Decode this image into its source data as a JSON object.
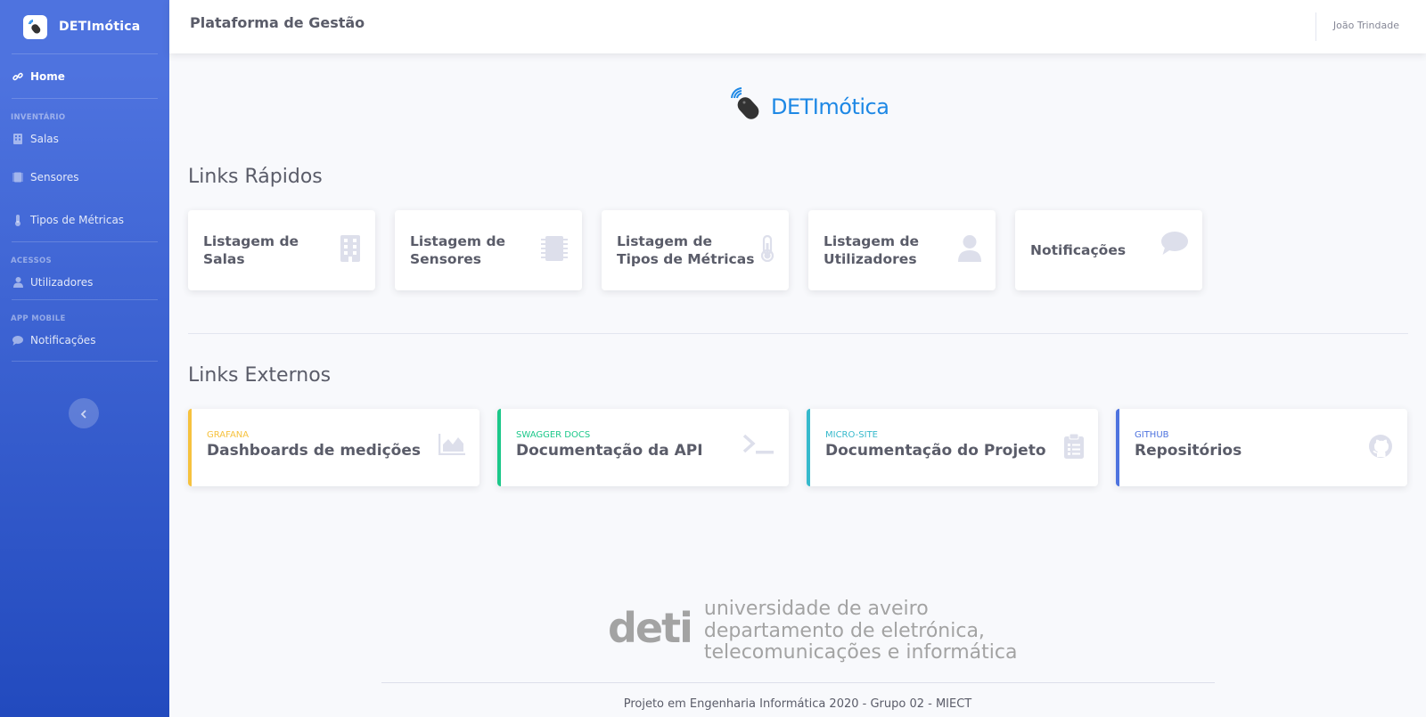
{
  "sidebar": {
    "brand": "DETImótica",
    "items": [
      {
        "label": "Home",
        "icon": "link-icon",
        "active": true
      },
      {
        "heading": "INVENTÁRIO"
      },
      {
        "label": "Salas",
        "icon": "building-icon"
      },
      {
        "label": "Sensores",
        "icon": "microchip-icon"
      },
      {
        "label": "Tipos de Métricas",
        "icon": "thermometer-icon"
      },
      {
        "heading": "ACESSOS"
      },
      {
        "label": "Utilizadores",
        "icon": "user-icon"
      },
      {
        "heading": "APP MOBILE"
      },
      {
        "label": "Notificações",
        "icon": "comment-icon"
      }
    ],
    "heading_inventario": "INVENTÁRIO",
    "heading_acessos": "ACESSOS",
    "heading_app": "APP MOBILE",
    "home": "Home",
    "salas": "Salas",
    "sensores": "Sensores",
    "tipos": "Tipos de Métricas",
    "utilizadores": "Utilizadores",
    "notificacoes": "Notificações"
  },
  "topbar": {
    "title": "Plataforma de Gestão",
    "user": "João Trindade"
  },
  "main": {
    "logo_text": "DETImótica",
    "quick_links_title": "Links Rápidos",
    "quick_links": [
      {
        "line1": "Listagem de Salas",
        "line2": "",
        "icon": "building-icon"
      },
      {
        "line1": "Listagem de",
        "line2": "Sensores",
        "icon": "microchip-icon"
      },
      {
        "line1": "Listagem de",
        "line2": "Tipos de Métricas",
        "icon": "thermometer-icon"
      },
      {
        "line1": "Listagem de",
        "line2": "Utilizadores",
        "icon": "user-icon"
      },
      {
        "line1": "Notificações",
        "line2": "",
        "icon": "comment-icon"
      }
    ],
    "external_links_title": "Links Externos",
    "external_links": [
      {
        "sub": "GRAFANA",
        "label": "Dashboards de medições",
        "color": "#f6c23e",
        "icon": "area-chart-icon"
      },
      {
        "sub": "SWAGGER DOCS",
        "label": "Documentação da API",
        "color": "#1cc88a",
        "icon": "terminal-icon"
      },
      {
        "sub": "MICRO-SITE",
        "label": "Documentação do Projeto",
        "color": "#36b9cc",
        "icon": "clipboard-icon"
      },
      {
        "sub": "GITHUB",
        "label": "Repositórios",
        "color": "#4e73df",
        "icon": "github-icon"
      }
    ]
  },
  "footer": {
    "deti_big": "deti",
    "deti_line1": "universidade de aveiro",
    "deti_line2": "departamento de eletrónica,",
    "deti_line3": "telecomunicações e informática",
    "text": "Projeto em Engenharia Informática 2020 - Grupo 02 - MIECT"
  },
  "colors": {
    "sidebar_top": "#4e73df",
    "sidebar_bottom": "#224abe",
    "accent_yellow": "#f6c23e",
    "accent_green": "#1cc88a",
    "accent_cyan": "#36b9cc",
    "accent_blue": "#4e73df",
    "logo_blue": "#1e88e5"
  }
}
